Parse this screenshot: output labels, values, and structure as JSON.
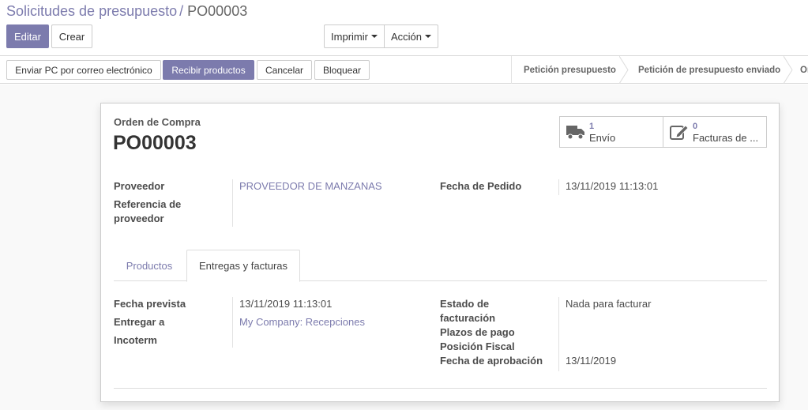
{
  "breadcrumb": {
    "parent": "Solicitudes de presupuesto",
    "separator": "/",
    "current": "PO00003"
  },
  "toolbar": {
    "edit_label": "Editar",
    "create_label": "Crear",
    "print_label": "Imprimir",
    "action_label": "Acción"
  },
  "statusbar": {
    "buttons": [
      "Enviar PC por correo electrónico",
      "Recibir productos",
      "Cancelar",
      "Bloquear"
    ],
    "stages": [
      "Petición presupuesto",
      "Petición de presupuesto enviado",
      "Or"
    ]
  },
  "smart_buttons": [
    {
      "count": "1",
      "label": "Envío",
      "icon": "truck-icon"
    },
    {
      "count": "0",
      "label": "Facturas de ...",
      "icon": "edit-icon"
    }
  ],
  "form": {
    "doc_type": "Orden de Compra",
    "name": "PO00003",
    "supplier_label": "Proveedor",
    "supplier_value": "PROVEEDOR DE MANZANAS",
    "supplier_ref_label": "Referencia de proveedor",
    "supplier_ref_label_line1": "Referencia de",
    "supplier_ref_label_line2": "proveedor",
    "order_date_label": "Fecha de Pedido",
    "order_date_value": "13/11/2019 11:13:01"
  },
  "tabs": [
    "Productos",
    "Entregas y facturas"
  ],
  "delivery": {
    "scheduled_label": "Fecha prevista",
    "scheduled_value": "13/11/2019 11:13:01",
    "deliver_to_label": "Entregar a",
    "deliver_to_value": "My Company: Recepciones",
    "incoterm_label": "Incoterm",
    "billing_status_label_line1": "Estado de",
    "billing_status_label_line2": "facturación",
    "billing_status_value": "Nada para facturar",
    "payment_terms_label": "Plazos de pago",
    "fiscal_position_label": "Posición Fiscal",
    "approval_date_label": "Fecha de aprobación",
    "approval_date_value": "13/11/2019"
  },
  "colors": {
    "accent": "#7c7bad",
    "text": "#4c4c4c",
    "border": "#cccccc",
    "background": "#f9f9f9"
  }
}
